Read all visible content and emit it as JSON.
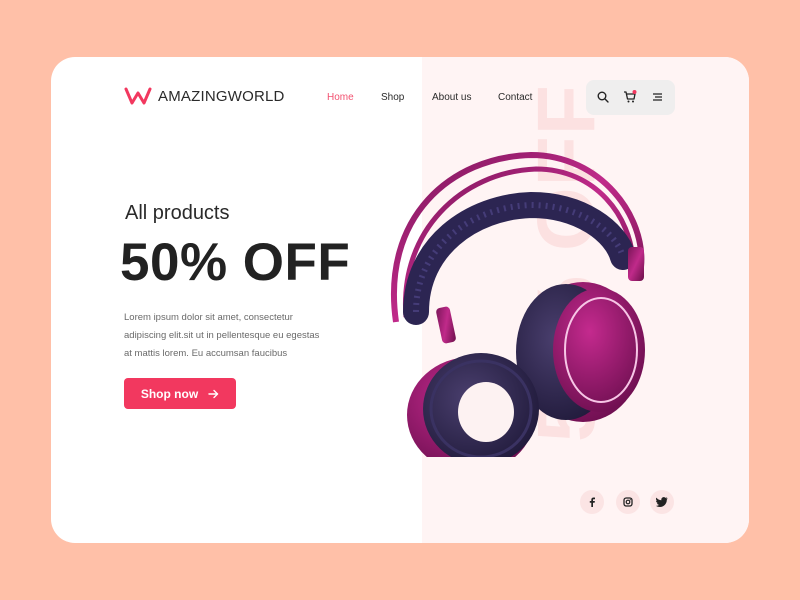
{
  "brand": {
    "name": "AMAZINGWORLD",
    "logo_icon": "w-logo-icon",
    "accent": "#F2385F"
  },
  "nav": {
    "items": [
      {
        "label": "Home",
        "active": true
      },
      {
        "label": "Shop",
        "active": false
      },
      {
        "label": "About us",
        "active": false
      },
      {
        "label": "Contact",
        "active": false
      }
    ]
  },
  "toolbar": {
    "icons": [
      "search-icon",
      "cart-icon",
      "menu-icon"
    ],
    "cart_has_badge": true
  },
  "hero": {
    "subtitle": "All products",
    "headline": "50% OFF",
    "description": "Lorem ipsum dolor sit amet, consectetur adipiscing elit.sit ut in pellentesque eu egestas at mattis lorem. Eu accumsan faucibus",
    "cta_label": "Shop now",
    "watermark": "50% OFF",
    "product_image": "headphones-image"
  },
  "social": {
    "icons": [
      "facebook-icon",
      "instagram-icon",
      "twitter-icon"
    ]
  },
  "colors": {
    "background": "#FFC0A8",
    "card": "#FFFFFF",
    "panel": "#FFF4F4",
    "watermark": "#FCE1E1"
  }
}
